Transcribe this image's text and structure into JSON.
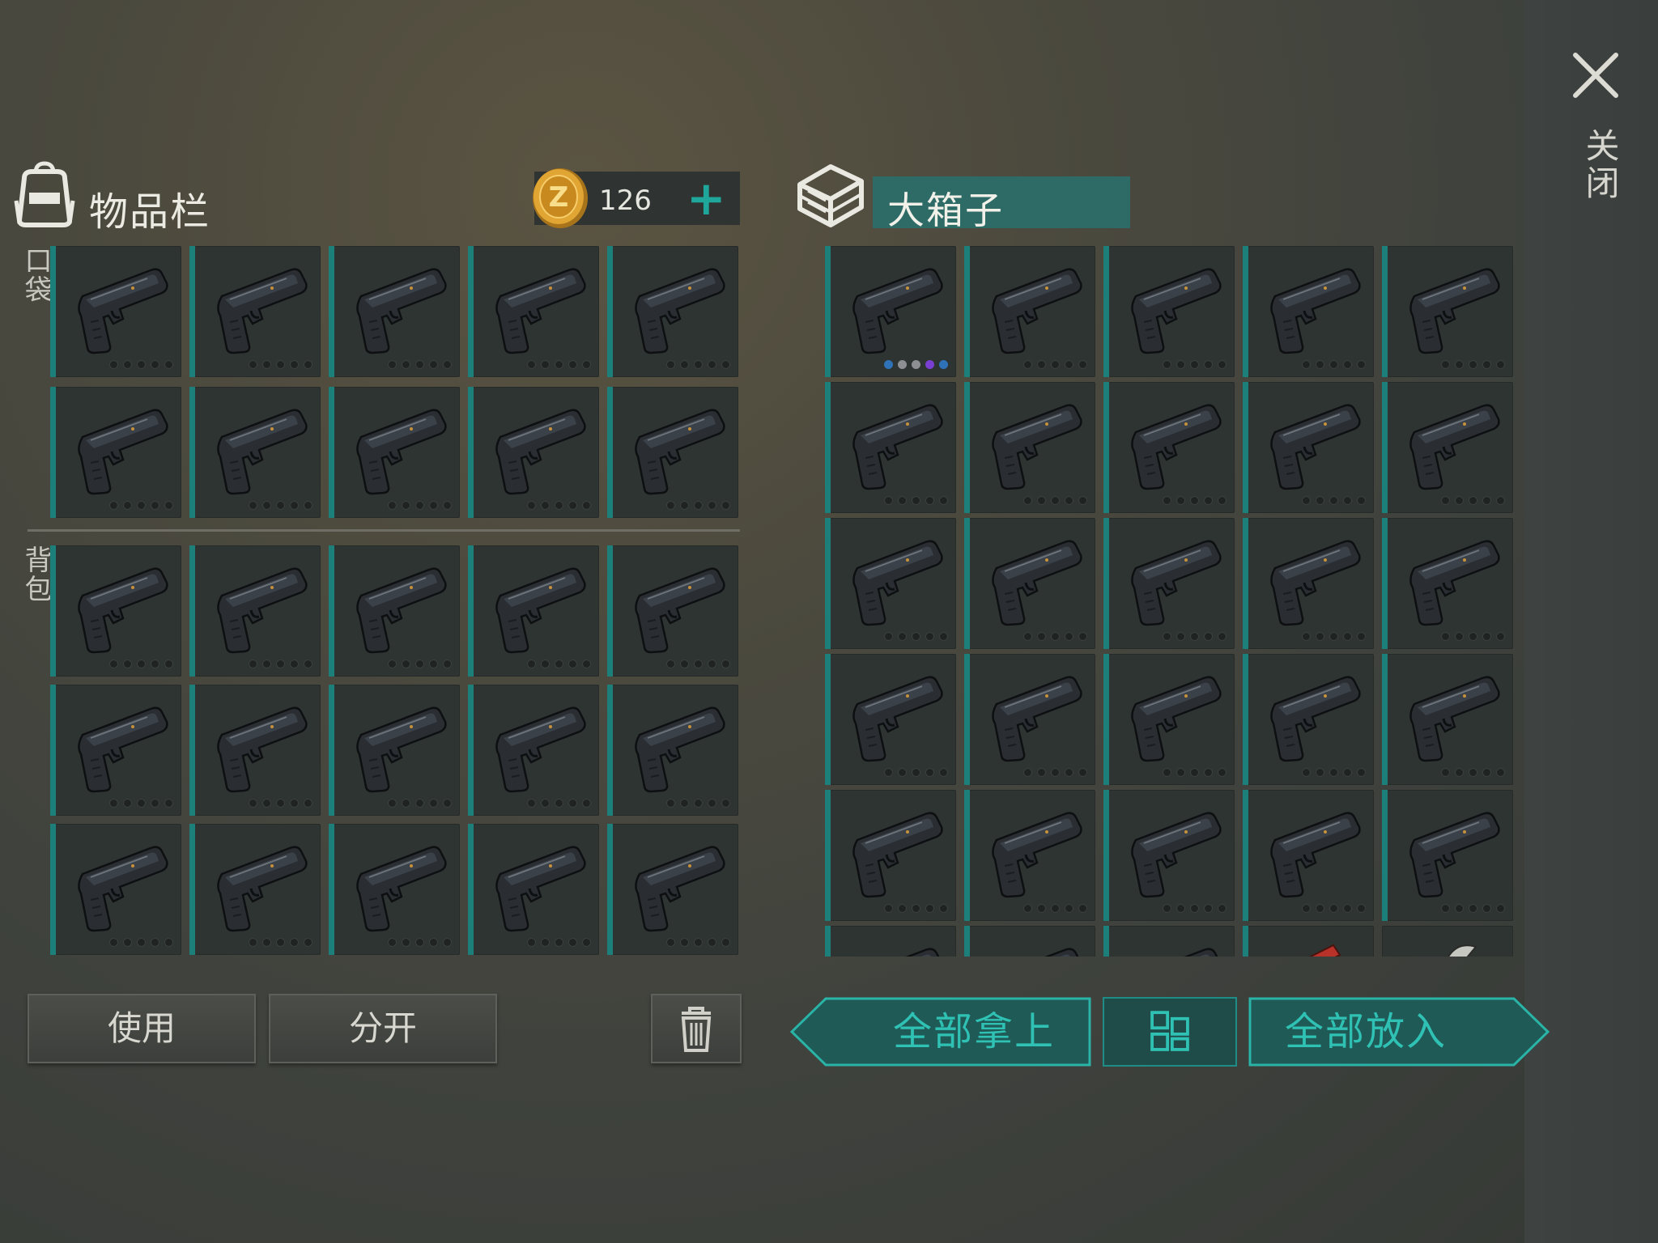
{
  "inventory": {
    "title": "物品栏",
    "pocket_label": "口袋",
    "backpack_label": "背包",
    "coins": "126",
    "add_label": "+"
  },
  "container": {
    "title": "大箱子"
  },
  "buttons": {
    "use": "使用",
    "split": "分开",
    "take_all": "全部拿上",
    "put_all": "全部放入",
    "close": "关闭"
  },
  "slots": {
    "pocket": {
      "rows": 2,
      "cols": 5,
      "item": "pistol-icon"
    },
    "backpack": {
      "rows": 3,
      "cols": 5,
      "item": "pistol-icon"
    },
    "box": {
      "rows": 6,
      "cols": 5,
      "item": "pistol-icon",
      "first_item_dots": [
        "#2f72b8",
        "#8d8f93",
        "#8d8f93",
        "#7a3fd0",
        "#2f72b8"
      ],
      "partial_row_items": [
        "pistol-icon",
        "pistol-icon",
        "pistol-icon",
        "flare-icon",
        "knife-icon"
      ]
    }
  },
  "colors": {
    "accent": "#1fa79c",
    "slot_bar": "#1d7f7a",
    "coin": "#e0a532"
  }
}
